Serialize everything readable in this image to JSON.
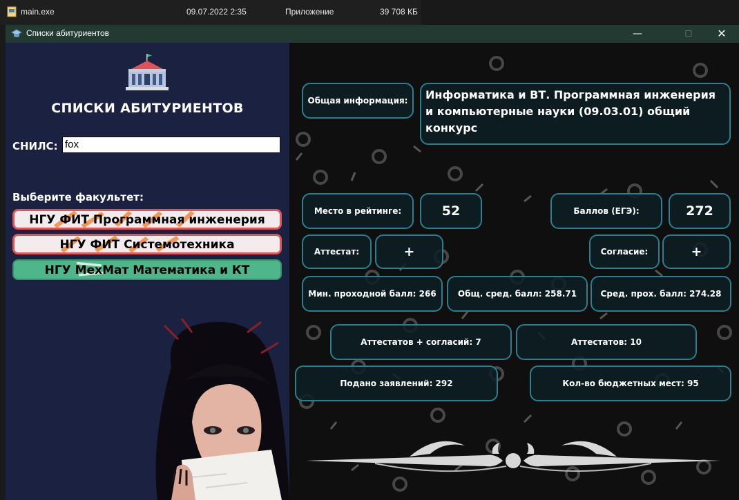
{
  "explorer": {
    "file_name": "main.exe",
    "date": "09.07.2022 2:35",
    "type": "Приложение",
    "size": "39 708 КБ"
  },
  "window": {
    "title": "Списки абитуриентов",
    "minimize": "—",
    "maximize": "☐",
    "close": "✕"
  },
  "left_panel": {
    "heading": "СПИСКИ АБИТУРИЕНТОВ",
    "snils_label": "СНИЛС:",
    "snils_value": "fox",
    "faculty_prompt": "Выберите факультет:",
    "faculties": [
      "НГУ ФИТ Программная инженерия",
      "НГУ ФИТ Системотехника",
      "НГУ МехМат Математика и КТ"
    ]
  },
  "right_panel": {
    "general_label": "Общая информация:",
    "general_value": "Информатика и ВТ. Программная инженерия и компьютерные науки (09.03.01) общий конкурс",
    "rank_label": "Место в рейтинге:",
    "rank_value": "52",
    "score_label": "Баллов (ЕГЭ):",
    "score_value": "272",
    "attestat_label": "Аттестат:",
    "attestat_value": "+",
    "consent_label": "Согласие:",
    "consent_value": "+",
    "min_pass": "Мин. проходной балл: 266",
    "avg_total": "Общ. сред. балл: 258.71",
    "avg_pass": "Сред. прох. балл: 274.28",
    "att_plus_consent": "Аттестатов + согласий: 7",
    "attestats": "Аттестатов: 10",
    "applications": "Подано заявлений: 292",
    "budget_places": "Кол-во бюджетных мест: 95"
  },
  "colors": {
    "left_bg": "#1b2140",
    "card_border": "#2b7f8e",
    "red_button_border": "#e2545a",
    "green_button": "#4fb58a",
    "titlebar": "#233a33"
  }
}
